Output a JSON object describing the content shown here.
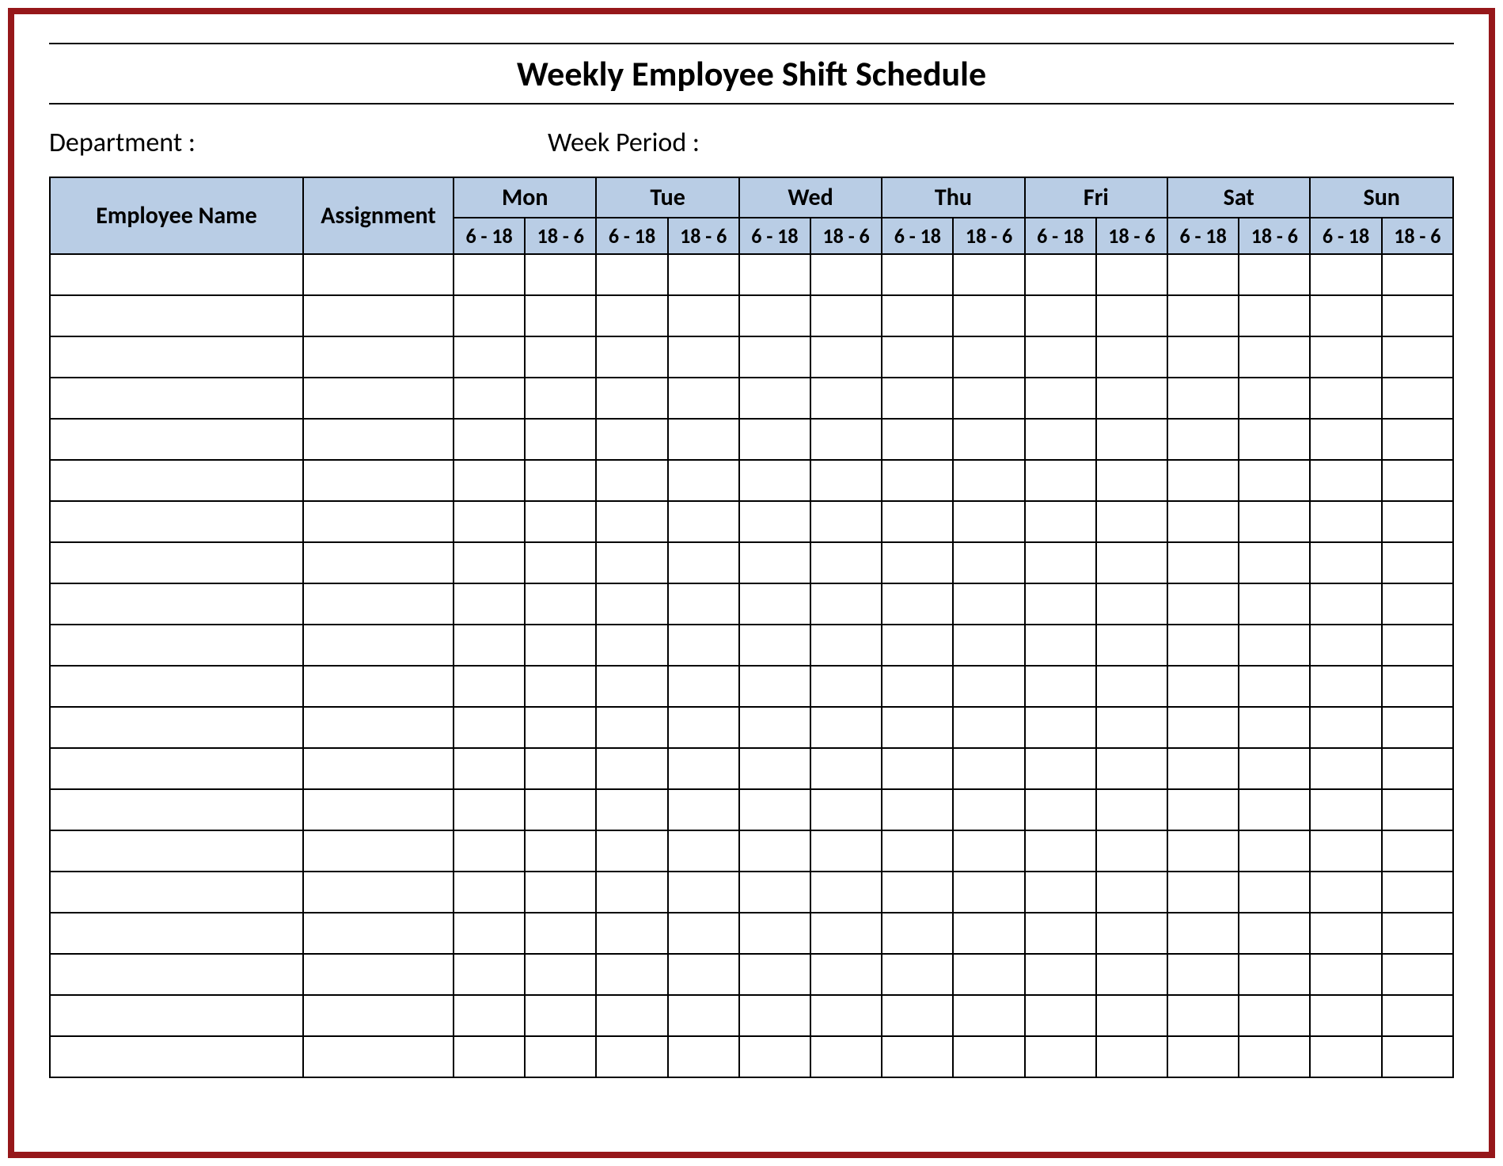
{
  "title": "Weekly Employee Shift Schedule",
  "meta": {
    "department_label": "Department :",
    "department_value": "",
    "week_period_label": "Week  Period :",
    "week_period_value": ""
  },
  "columns": {
    "employee_name": "Employee Name",
    "assignment": "Assignment"
  },
  "days": [
    {
      "label": "Mon",
      "shifts": [
        "6 - 18",
        "18 - 6"
      ]
    },
    {
      "label": "Tue",
      "shifts": [
        "6 - 18",
        "18 - 6"
      ]
    },
    {
      "label": "Wed",
      "shifts": [
        "6 - 18",
        "18 - 6"
      ]
    },
    {
      "label": "Thu",
      "shifts": [
        "6 - 18",
        "18 - 6"
      ]
    },
    {
      "label": "Fri",
      "shifts": [
        "6 - 18",
        "18 - 6"
      ]
    },
    {
      "label": "Sat",
      "shifts": [
        "6 - 18",
        "18 - 6"
      ]
    },
    {
      "label": "Sun",
      "shifts": [
        "6 - 18",
        "18 - 6"
      ]
    }
  ],
  "row_count": 20
}
